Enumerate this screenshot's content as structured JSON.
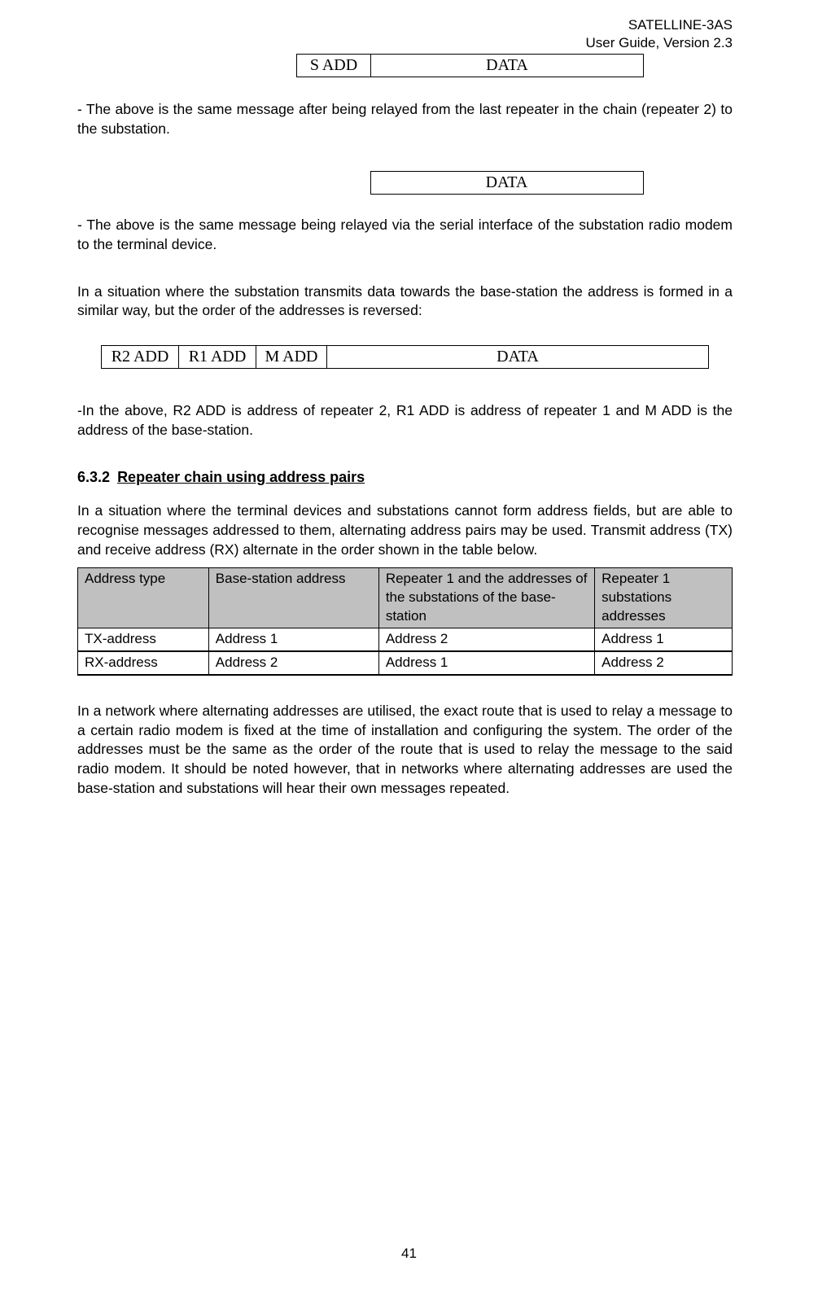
{
  "header": {
    "line1": "SATELLINE-3AS",
    "line2": "User Guide, Version 2.3"
  },
  "msg_table1": {
    "c1": "S ADD",
    "c2": "DATA"
  },
  "para1": "- The above is the same message after being relayed from the last repeater in the chain (repeater 2) to the substation.",
  "msg_table2": {
    "c1": "DATA"
  },
  "para2": "- The above is the same message being relayed via the serial interface of the substation radio modem to the terminal device.",
  "para3": "In a situation where the substation transmits data towards the base-station the address is formed in a similar way, but the order of the addresses is reversed:",
  "msg_table3": {
    "c1": "R2 ADD",
    "c2": "R1 ADD",
    "c3": "M ADD",
    "c4": "DATA"
  },
  "para4": "-In the above, R2 ADD is address of repeater 2, R1 ADD is address of repeater 1 and M ADD is the address of the base-station.",
  "section": {
    "num": "6.3.2",
    "title": "Repeater chain using address pairs"
  },
  "para5": "In a situation where the terminal devices and substations cannot form address fields, but are able to recognise messages addressed to them, alternating address pairs may be used. Transmit address (TX) and receive address (RX) alternate in the order shown in the table below.",
  "addr_table": {
    "headers": [
      "Address type",
      "Base-station address",
      "Repeater 1 and the addresses of the substations of the base-station",
      "Repeater 1 substations addresses"
    ],
    "rows": [
      [
        "TX-address",
        "Address 1",
        "Address 2",
        "Address 1"
      ],
      [
        "RX-address",
        "Address 2",
        "Address 1",
        "Address 2"
      ]
    ]
  },
  "para6": "In a network where alternating addresses are utilised, the exact route that is used to relay a message to a certain radio modem is fixed at the time of installation and configuring the system. The order of the addresses must be the same as the order of the route that is used to relay the message to the said radio modem. It should be noted however, that in networks where alternating addresses are used the base-station and substations will hear their own messages repeated.",
  "pagenum": "41"
}
